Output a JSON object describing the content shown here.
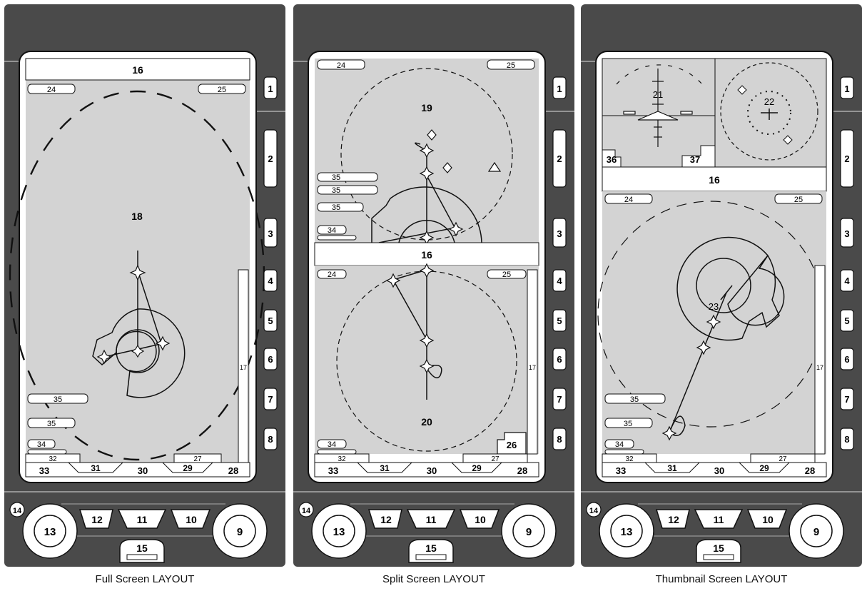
{
  "captions": {
    "full": "Full Screen LAYOUT",
    "split": "Split Screen LAYOUT",
    "thumb": "Thumbnail Screen LAYOUT"
  },
  "softkeys": [
    "1",
    "2",
    "3",
    "4",
    "5",
    "6",
    "7",
    "8"
  ],
  "controls": {
    "left_knob": "13",
    "right_knob": "9",
    "key_left": "12",
    "key_center": "11",
    "key_right": "10",
    "bottom_key": "15",
    "corner_marker": "14"
  },
  "labels": {
    "banner": "16",
    "side_bar": "17",
    "full_map": "18",
    "split_top_map": "19",
    "split_bottom_map": "20",
    "thumb_attitude": "21",
    "thumb_map": "22",
    "thumb_route": "23",
    "top_left_box": "24",
    "top_right_box": "25",
    "split_box": "26",
    "bottom_right_box": "27",
    "strip_right": "28",
    "strip_29": "29",
    "strip_center": "30",
    "strip_31": "31",
    "bottom_left_box": "32",
    "strip_left": "33",
    "small_tag": "34",
    "data_tag": "35",
    "thumb_left_box": "36",
    "thumb_right_box": "37"
  },
  "colors": {
    "bezel": "#4a4a4a",
    "map_background": "#d3d3d3",
    "screen_white": "#ffffff",
    "outline": "#111111"
  }
}
